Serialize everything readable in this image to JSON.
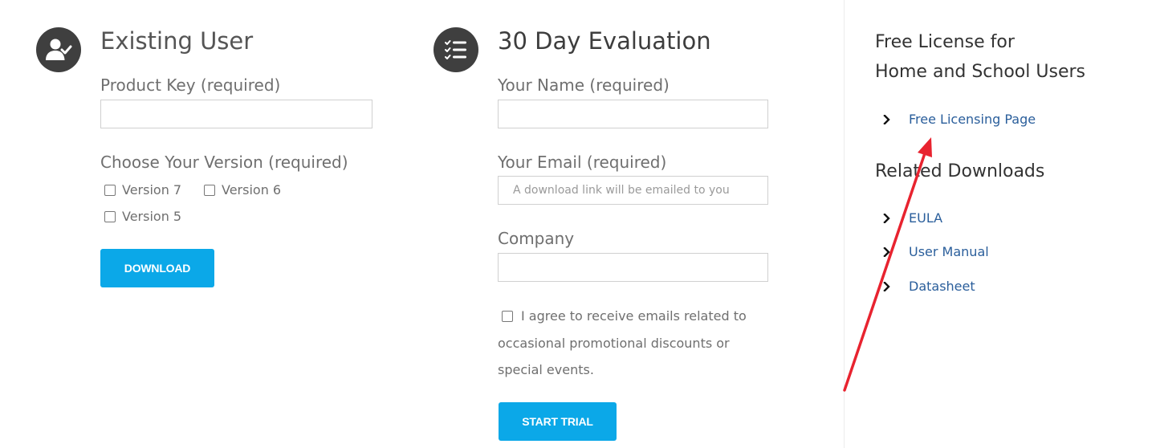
{
  "existing_user": {
    "heading": "Existing User",
    "product_key_label": "Product Key (required)",
    "product_key_value": "",
    "version_label": "Choose Your Version (required)",
    "versions": [
      "Version 7",
      "Version 6",
      "Version 5"
    ],
    "download_label": "DOWNLOAD"
  },
  "evaluation": {
    "heading": "30 Day Evaluation",
    "name_label": "Your Name (required)",
    "name_value": "",
    "email_label": "Your Email (required)",
    "email_placeholder": "A download link will be emailed to you",
    "company_label": "Company",
    "company_value": "",
    "agree_text": "I agree to receive emails related to occasional promotional discounts or special events.",
    "start_label": "START TRIAL"
  },
  "sidebar": {
    "license_title_line1": "Free License for",
    "license_title_line2": "Home and School Users",
    "free_link": "Free Licensing Page",
    "related_title": "Related Downloads",
    "related_links": [
      "EULA",
      "User Manual",
      "Datasheet"
    ]
  },
  "icons": {
    "existing_user": "user-check-icon",
    "evaluation": "checklist-icon",
    "chevron": "chevron-right-icon",
    "annotation": "red-arrow-annotation"
  },
  "colors": {
    "button": "#0ba8e8",
    "link": "#2a5e9b",
    "icon_circle": "#3f3f3f",
    "annotation": "#e8232f"
  }
}
